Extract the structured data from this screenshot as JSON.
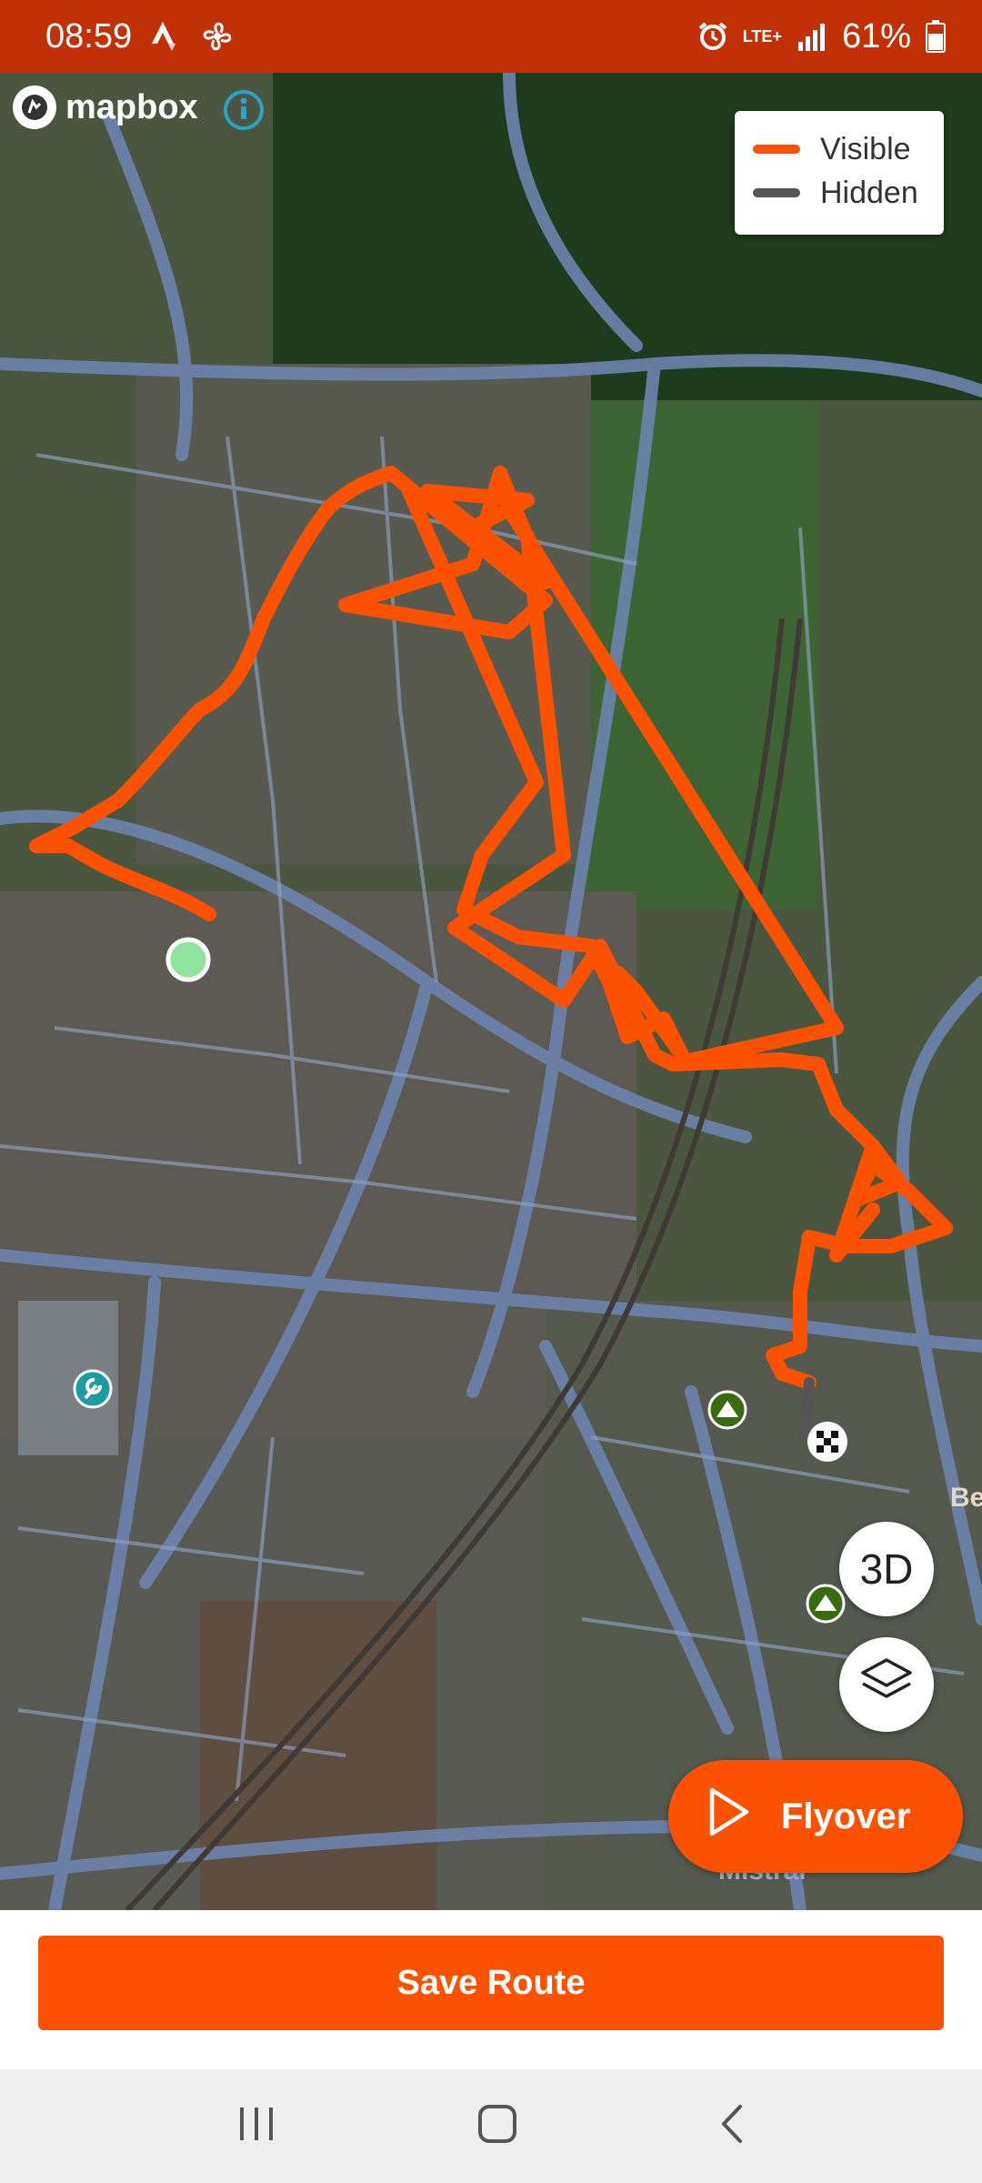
{
  "status_bar": {
    "time": "08:59",
    "network": "LTE+",
    "battery": "61%",
    "icons": [
      "strava-notification-icon",
      "fan-icon",
      "alarm-icon",
      "signal-icon",
      "battery-icon"
    ]
  },
  "map": {
    "provider_logo": "mapbox",
    "legend": {
      "visible_label": "Visible",
      "hidden_label": "Hidden",
      "visible_color": "#fc5200",
      "hidden_color": "#555555"
    },
    "place_labels": {
      "be": "Be",
      "mistral": "Mistral"
    },
    "controls": {
      "three_d_label": "3D",
      "layers_icon": "layers-icon",
      "flyover_label": "Flyover"
    }
  },
  "actions": {
    "save_label": "Save Route"
  },
  "colors": {
    "accent": "#fc5200",
    "status_bar": "#c23005"
  }
}
